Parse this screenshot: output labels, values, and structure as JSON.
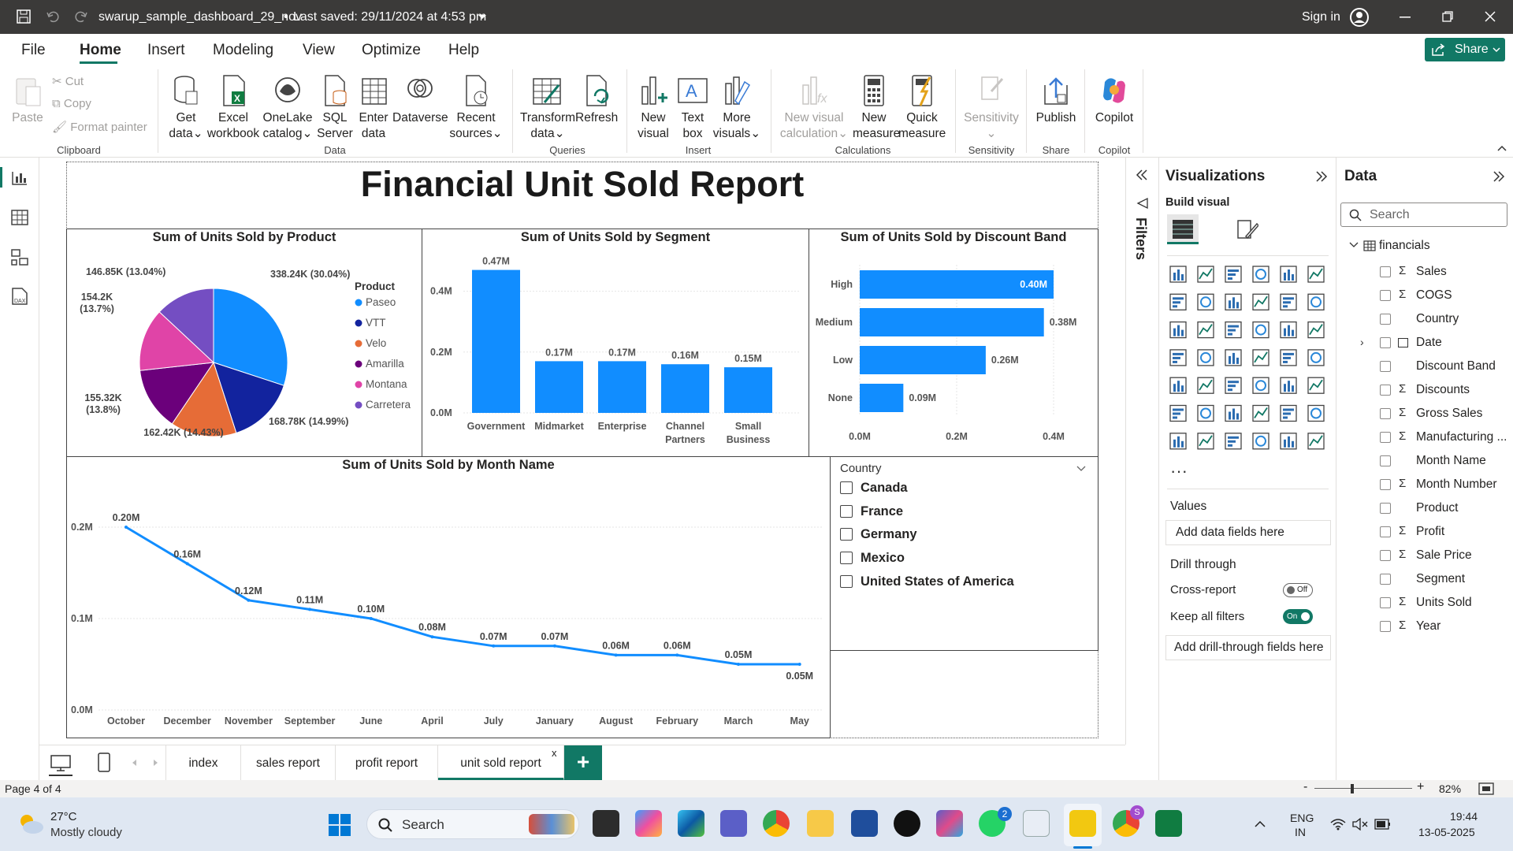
{
  "titlebar": {
    "file_title": "swarup_sample_dashboard_29_nov",
    "saved": "Last saved: 29/11/2024 at 4:53 pm",
    "sign_in": "Sign in"
  },
  "menu": [
    "File",
    "Home",
    "Insert",
    "Modeling",
    "View",
    "Optimize",
    "Help"
  ],
  "share_label": "Share",
  "ribbon": {
    "clipboard": {
      "paste": "Paste",
      "cut": "Cut",
      "copy": "Copy",
      "format_painter": "Format painter",
      "group": "Clipboard"
    },
    "data": {
      "get_data": [
        "Get",
        "data"
      ],
      "excel": [
        "Excel",
        "workbook"
      ],
      "onelake": [
        "OneLake",
        "catalog"
      ],
      "sql": [
        "SQL",
        "Server"
      ],
      "enter": [
        "Enter",
        "data"
      ],
      "dataverse": "Dataverse",
      "recent": [
        "Recent",
        "sources"
      ],
      "group": "Data"
    },
    "queries": {
      "transform": [
        "Transform",
        "data"
      ],
      "refresh": "Refresh",
      "group": "Queries"
    },
    "insert": {
      "new_visual": [
        "New",
        "visual"
      ],
      "text_box": [
        "Text",
        "box"
      ],
      "more_visuals": [
        "More",
        "visuals"
      ],
      "group": "Insert"
    },
    "calculations": {
      "new_visual_calc": [
        "New visual",
        "calculation"
      ],
      "new_measure": [
        "New",
        "measure"
      ],
      "quick_measure": [
        "Quick",
        "measure"
      ],
      "group": "Calculations"
    },
    "sensitivity": {
      "label": "Sensitivity",
      "group": "Sensitivity"
    },
    "share": {
      "publish": "Publish",
      "group": "Share"
    },
    "copilot": {
      "label": "Copilot",
      "group": "Copilot"
    }
  },
  "report_title": "Financial Unit Sold Report",
  "pie": {
    "title": "Sum of Units Sold by Product",
    "legend_title": "Product",
    "slices": [
      {
        "name": "Paseo",
        "value": 338.24,
        "label": "338.24K (30.04%)",
        "color": "#118dff"
      },
      {
        "name": "VTT",
        "value": 168.78,
        "label": "168.78K (14.99%)",
        "color": "#12239e"
      },
      {
        "name": "Velo",
        "value": 162.42,
        "label": "162.42K (14.43%)",
        "color": "#e66c37"
      },
      {
        "name": "Amarilla",
        "value": 155.32,
        "label": "155.32K (13.8%)",
        "color": "#6b007b"
      },
      {
        "name": "Montana",
        "value": 154.2,
        "label": "154.2K (13.7%)",
        "color": "#e044a7"
      },
      {
        "name": "Carretera",
        "value": 146.85,
        "label": "146.85K (13.04%)",
        "color": "#744ec2"
      }
    ]
  },
  "chart_data": [
    {
      "type": "bar",
      "title": "Sum of Units Sold by Segment",
      "categories": [
        "Government",
        "Midmarket",
        "Enterprise",
        "Channel Partners",
        "Small Business"
      ],
      "values": [
        0.47,
        0.17,
        0.17,
        0.16,
        0.15
      ],
      "labels": [
        "0.47M",
        "0.17M",
        "0.17M",
        "0.16M",
        "0.15M"
      ],
      "yticks": [
        "0.0M",
        "0.2M",
        "0.4M"
      ],
      "ylim": [
        0,
        0.5
      ]
    },
    {
      "type": "bar",
      "orientation": "horizontal",
      "title": "Sum of Units Sold by Discount Band",
      "categories": [
        "High",
        "Medium",
        "Low",
        "None"
      ],
      "values": [
        0.4,
        0.38,
        0.26,
        0.09
      ],
      "labels": [
        "0.40M",
        "0.38M",
        "0.26M",
        "0.09M"
      ],
      "xticks": [
        "0.0M",
        "0.2M",
        "0.4M"
      ],
      "xlim": [
        0,
        0.4
      ]
    },
    {
      "type": "line",
      "title": "Sum of Units Sold by Month Name",
      "categories": [
        "October",
        "December",
        "November",
        "September",
        "June",
        "April",
        "July",
        "January",
        "August",
        "February",
        "March",
        "May"
      ],
      "values": [
        0.2,
        0.16,
        0.12,
        0.11,
        0.1,
        0.08,
        0.07,
        0.07,
        0.06,
        0.06,
        0.05,
        0.05
      ],
      "labels": [
        "0.20M",
        "0.16M",
        "0.12M",
        "0.11M",
        "0.10M",
        "0.08M",
        "0.07M",
        "0.07M",
        "0.06M",
        "0.06M",
        "0.05M",
        "0.05M"
      ],
      "yticks": [
        "0.0M",
        "0.1M",
        "0.2M"
      ],
      "ylim": [
        0,
        0.2
      ]
    }
  ],
  "slicer": {
    "title": "Country",
    "items": [
      "Canada",
      "France",
      "Germany",
      "Mexico",
      "United States of America"
    ]
  },
  "filters_label": "Filters",
  "visualizations": {
    "title": "Visualizations",
    "build": "Build visual",
    "values": "Values",
    "add_data": "Add data fields here",
    "drill": "Drill through",
    "cross": "Cross-report",
    "cross_state": "Off",
    "keep": "Keep all filters",
    "keep_state": "On",
    "add_drill": "Add drill-through fields here"
  },
  "data_pane": {
    "title": "Data",
    "search": "Search",
    "table": "financials",
    "fields": [
      {
        "name": "Sales",
        "sigma": true
      },
      {
        "name": "COGS",
        "sigma": true
      },
      {
        "name": "Country",
        "sigma": false
      },
      {
        "name": "Date",
        "sigma": false,
        "date": true
      },
      {
        "name": "Discount Band",
        "sigma": false
      },
      {
        "name": "Discounts",
        "sigma": true
      },
      {
        "name": "Gross Sales",
        "sigma": true
      },
      {
        "name": "Manufacturing ...",
        "sigma": true
      },
      {
        "name": "Month Name",
        "sigma": false
      },
      {
        "name": "Month Number",
        "sigma": true
      },
      {
        "name": "Product",
        "sigma": false
      },
      {
        "name": "Profit",
        "sigma": true
      },
      {
        "name": "Sale Price",
        "sigma": true
      },
      {
        "name": "Segment",
        "sigma": false
      },
      {
        "name": "Units Sold",
        "sigma": true
      },
      {
        "name": "Year",
        "sigma": true
      }
    ]
  },
  "tabs": [
    "index",
    "sales report",
    "profit report",
    "unit sold report"
  ],
  "status": {
    "page": "Page 4 of 4",
    "zoom": "82%"
  },
  "taskbar": {
    "temp": "27°C",
    "weather": "Mostly cloudy",
    "search": "Search",
    "lang1": "ENG",
    "lang2": "IN",
    "time": "19:44",
    "date": "13-05-2025",
    "badge_teams": "2",
    "badge_chrome": "S"
  }
}
